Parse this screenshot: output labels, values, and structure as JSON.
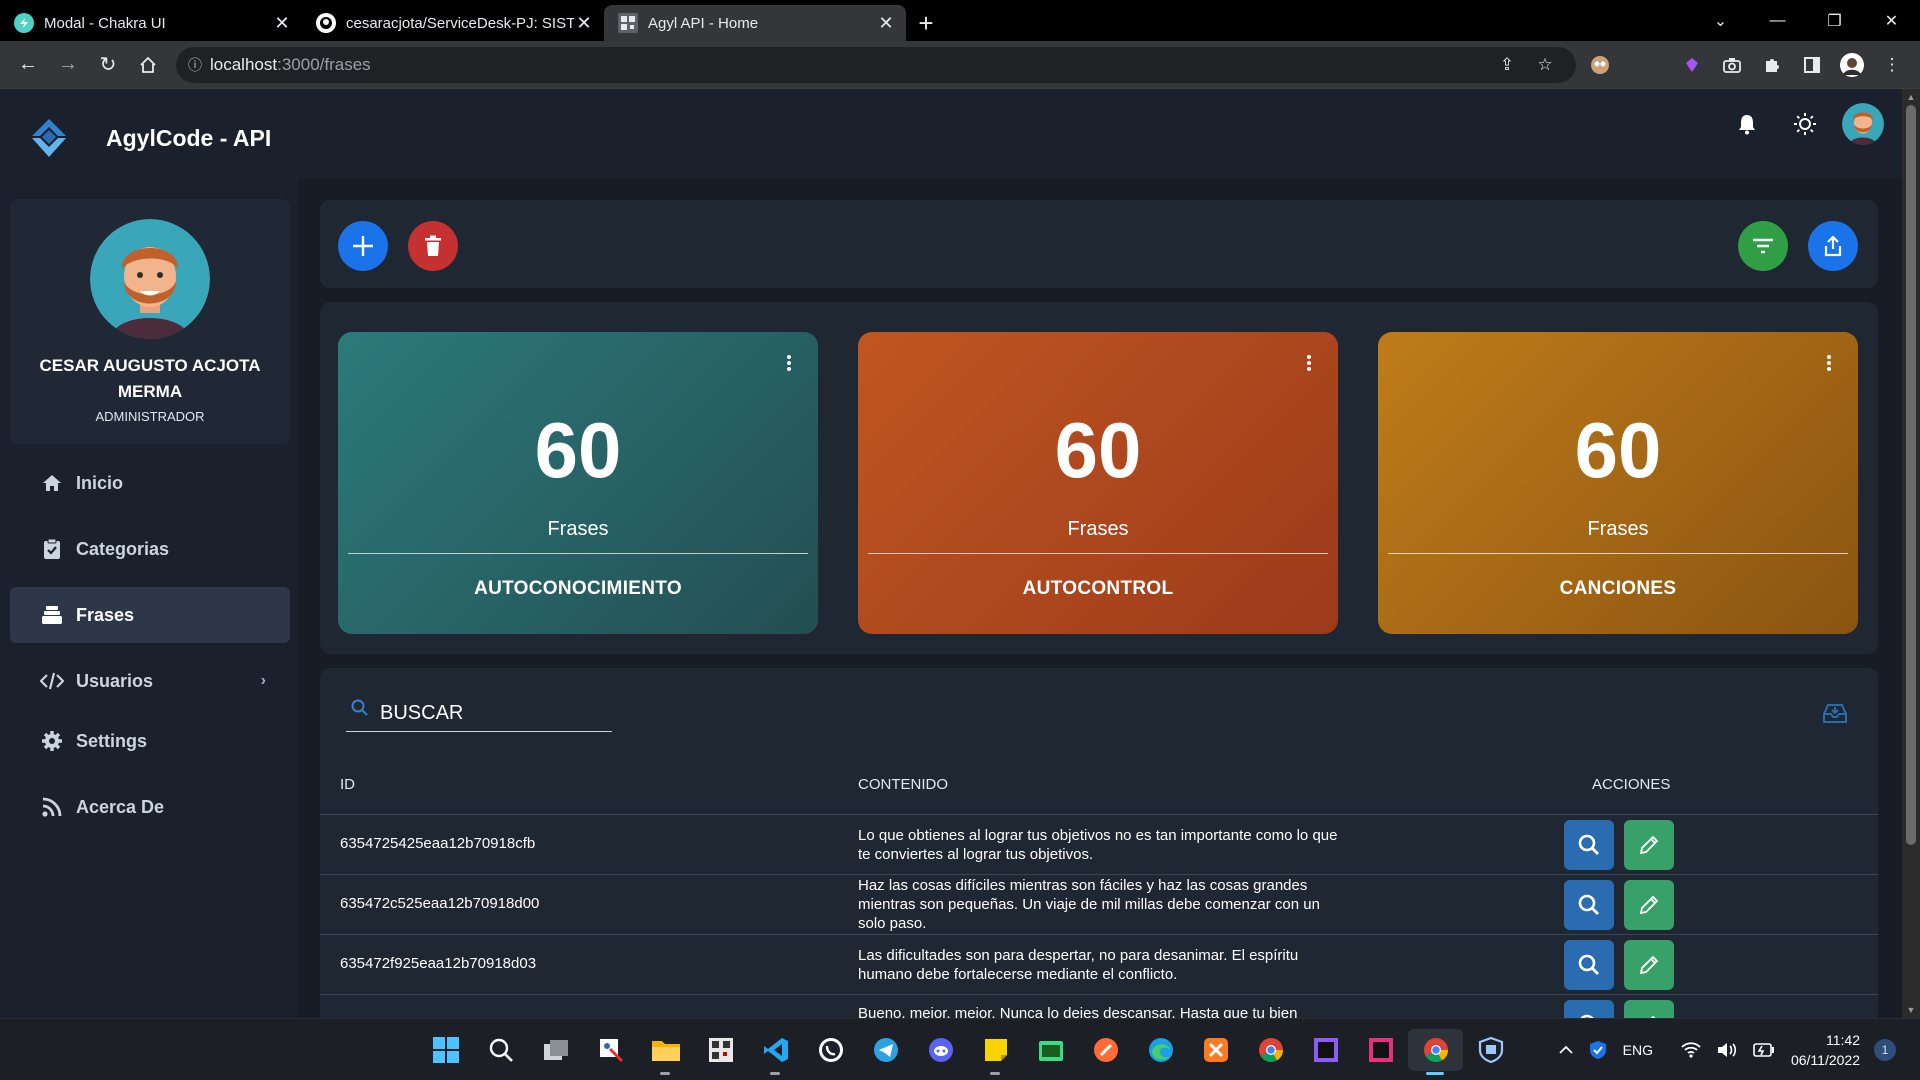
{
  "browser": {
    "tabs": [
      {
        "title": "Modal - Chakra UI",
        "active": false
      },
      {
        "title": "cesaracjota/ServiceDesk-PJ: SISTE",
        "active": false
      },
      {
        "title": "Agyl API - Home",
        "active": true
      }
    ],
    "url_host": "localhost",
    "url_path": ":3000/frases"
  },
  "app": {
    "brand": "AgylCode - API",
    "user": {
      "name": "CESAR AUGUSTO ACJOTA MERMA",
      "role": "ADMINISTRADOR"
    },
    "menu": [
      {
        "label": "Inicio",
        "icon": "home-icon",
        "active": false
      },
      {
        "label": "Categorias",
        "icon": "clipboard-check-icon",
        "active": false
      },
      {
        "label": "Frases",
        "icon": "stack-icon",
        "active": true
      },
      {
        "label": "Usuarios",
        "icon": "code-icon",
        "active": false,
        "has_submenu": true
      },
      {
        "label": "Settings",
        "icon": "gear-icon",
        "active": false
      },
      {
        "label": "Acerca De",
        "icon": "rss-icon",
        "active": false
      }
    ],
    "colors": {
      "add": "#1a73e8",
      "delete": "#c53030",
      "filter": "#2f9e44",
      "export": "#1a73e8",
      "view": "#2b6cb0",
      "edit": "#38a169"
    },
    "cards": [
      {
        "count": "60",
        "unit": "Frases",
        "category": "AUTOCONOCIMIENTO",
        "gradient": [
          "#2c7a7b",
          "#234e52"
        ]
      },
      {
        "count": "60",
        "unit": "Frases",
        "category": "AUTOCONTROL",
        "gradient": [
          "#c05621",
          "#9c3a1a"
        ]
      },
      {
        "count": "60",
        "unit": "Frases",
        "category": "CANCIONES",
        "gradient": [
          "#c07c1a",
          "#8a5411"
        ]
      }
    ],
    "search": {
      "label": "BUSCAR"
    },
    "table": {
      "headers": {
        "id": "ID",
        "content": "CONTENIDO",
        "actions": "ACCIONES"
      },
      "rows": [
        {
          "id": "6354725425eaa12b70918cfb",
          "content": "Lo que obtienes al lograr tus objetivos no es tan importante como lo que te conviertes al lograr tus objetivos."
        },
        {
          "id": "635472c525eaa12b70918d00",
          "content": "Haz las cosas difíciles mientras son fáciles y haz las cosas grandes mientras son pequeñas. Un viaje de mil millas debe comenzar con un solo paso."
        },
        {
          "id": "635472f925eaa12b70918d03",
          "content": "Las dificultades son para despertar, no para desanimar. El espíritu humano debe fortalecerse mediante el conflicto."
        },
        {
          "id": "",
          "content": "Bueno, mejor, mejor. Nunca lo dejes descansar. Hasta que tu bien"
        }
      ]
    }
  },
  "taskbar": {
    "language": "ENG",
    "time": "11:42",
    "date": "06/11/2022",
    "notifications": "1"
  }
}
